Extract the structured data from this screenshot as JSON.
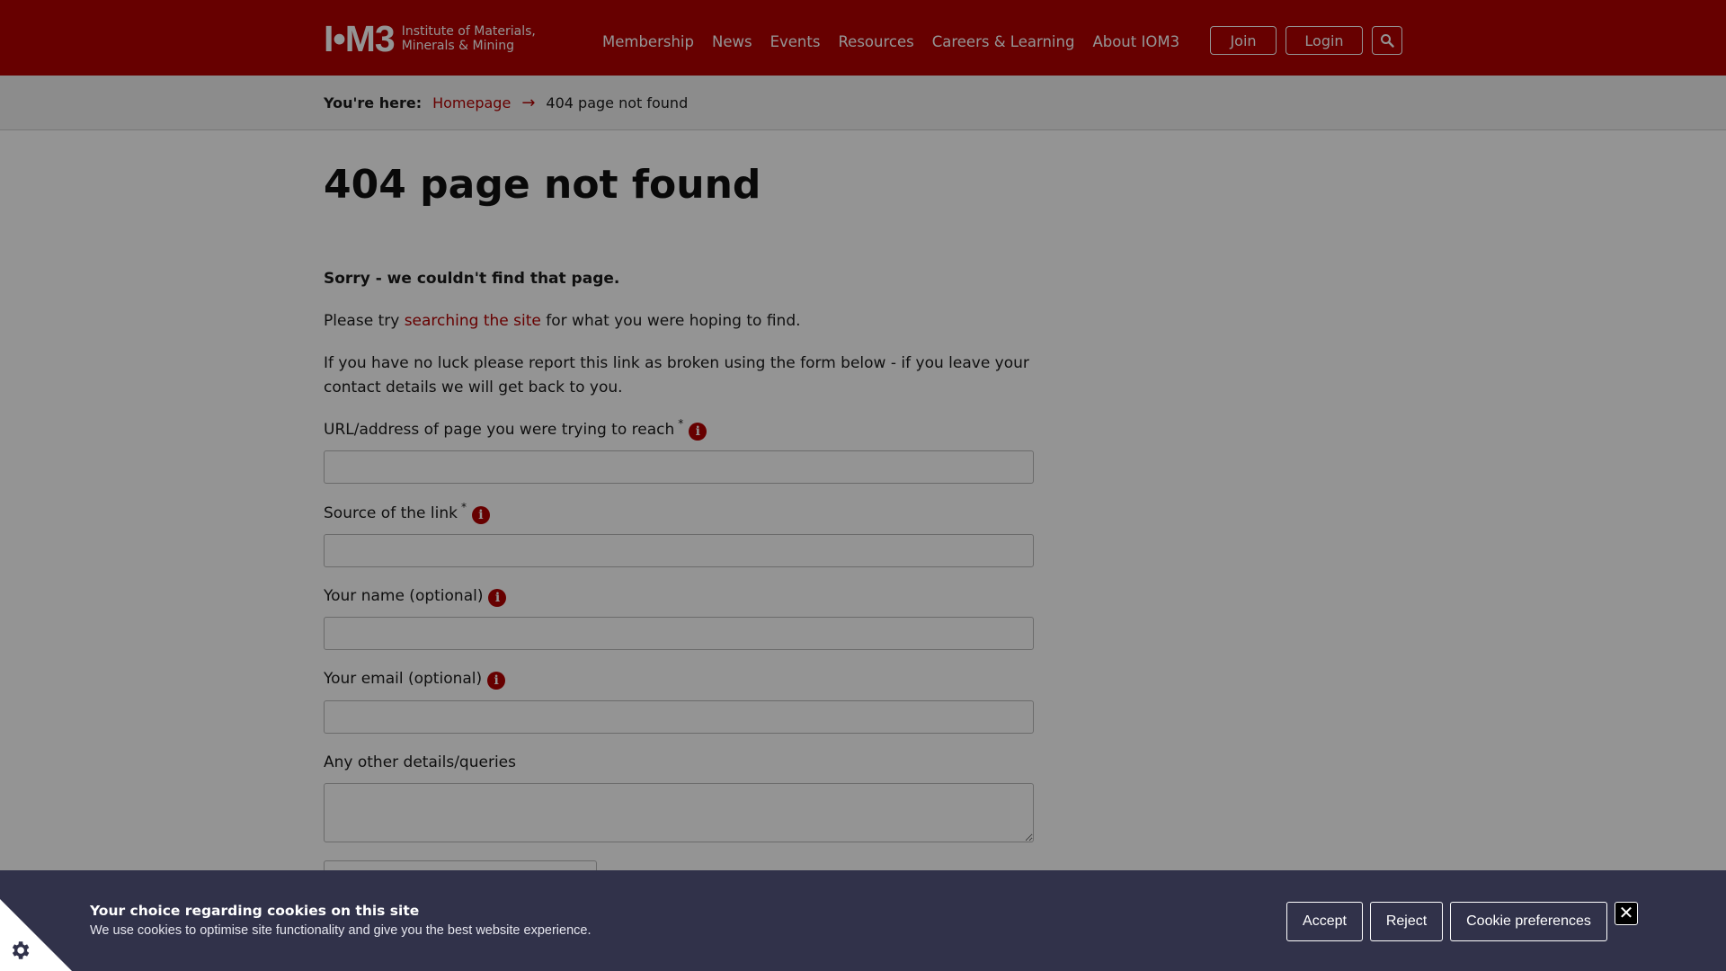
{
  "colors": {
    "brand": "#b10000",
    "banner": "#31324a",
    "overlay": "rgba(0,0,0,0.42)"
  },
  "header": {
    "logo_mark": "I•M3",
    "logo_line1": "Institute of Materials,",
    "logo_line2": "Minerals & Mining",
    "nav": [
      "Membership",
      "News",
      "Events",
      "Resources",
      "Careers & Learning",
      "About IOM3"
    ],
    "join_label": "Join",
    "login_label": "Login",
    "search_icon": "search-icon"
  },
  "breadcrumb": {
    "label": "You're here:",
    "home": "Homepage",
    "arrow": "→",
    "current": "404 page not found"
  },
  "main": {
    "title": "404 page not found",
    "sorry": "Sorry - we couldn't find that page.",
    "try_prefix": "Please try ",
    "try_link": "searching the site",
    "try_suffix": " for what you were hoping to find.",
    "report_text": "If you have no luck please report this link as broken using the form below - if you leave your contact details we will get back to you."
  },
  "form": {
    "url_label": "URL/address of page you were trying to reach",
    "url_value": "",
    "source_label": "Source of the link",
    "source_value": "",
    "name_label": "Your name (optional)",
    "name_value": "",
    "email_label": "Your email (optional)",
    "email_value": "",
    "details_label": "Any other details/queries",
    "details_value": "",
    "required_mark": "*",
    "info_glyph": "i"
  },
  "cookie": {
    "title": "Your choice regarding cookies on this site",
    "text": "We use cookies to optimise site functionality and give you the best website experience.",
    "accept_label": "Accept",
    "reject_label": "Reject",
    "prefs_label": "Cookie preferences",
    "close_glyph": "✕",
    "gear_icon": "gear-icon"
  }
}
